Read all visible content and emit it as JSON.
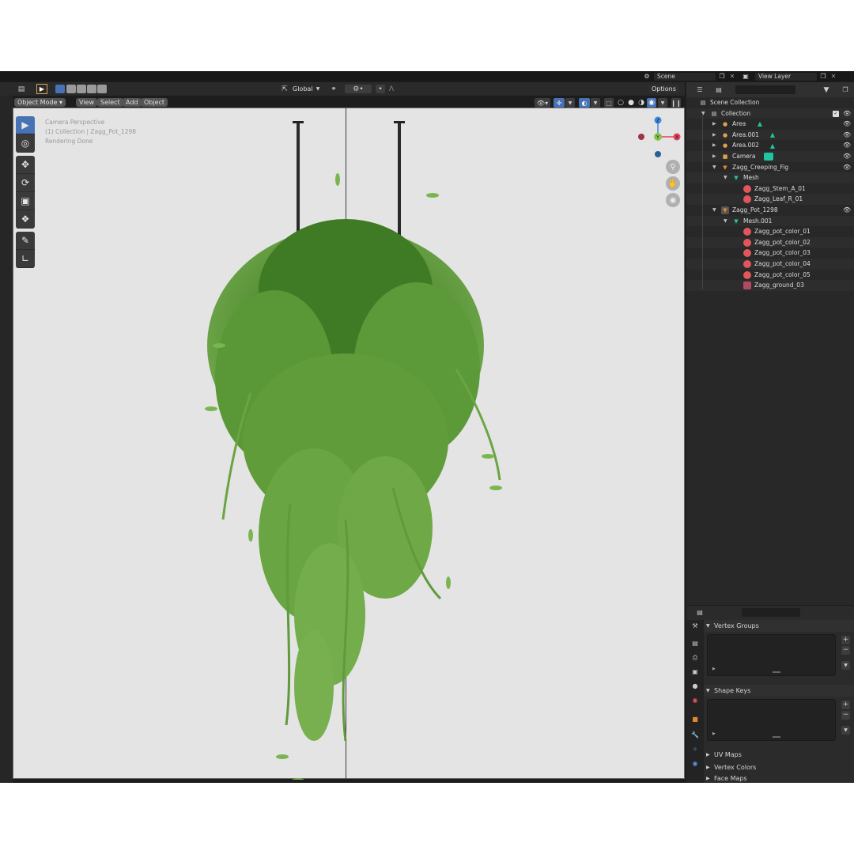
{
  "top_bar": {
    "scene_label": "Scene",
    "view_layer_label": "View Layer"
  },
  "header": {
    "transform_orientation": "Global",
    "options_label": "Options"
  },
  "viewport_menu": {
    "mode": "Object Mode",
    "view": "View",
    "select": "Select",
    "add": "Add",
    "object": "Object"
  },
  "viewport_info": {
    "line1": "Camera Perspective",
    "line2": "(1) Collection | Zagg_Pot_1298",
    "line3": "Rendering Done"
  },
  "gizmo": {
    "z": "Z",
    "y": "Y",
    "x": "X"
  },
  "outliner": {
    "search_placeholder": "",
    "scene_collection": "Scene Collection",
    "items": [
      {
        "label": "Collection"
      },
      {
        "label": "Area"
      },
      {
        "label": "Area.001"
      },
      {
        "label": "Area.002"
      },
      {
        "label": "Camera"
      },
      {
        "label": "Zagg_Creeping_Fig"
      },
      {
        "label": "Mesh"
      },
      {
        "label": "Zagg_Stem_A_01"
      },
      {
        "label": "Zagg_Leaf_R_01"
      },
      {
        "label": "Zagg_Pot_1298"
      },
      {
        "label": "Mesh.001"
      },
      {
        "label": "Zagg_pot_color_01"
      },
      {
        "label": "Zagg_pot_color_02"
      },
      {
        "label": "Zagg_pot_color_03"
      },
      {
        "label": "Zagg_pot_color_04"
      },
      {
        "label": "Zagg_pot_color_05"
      },
      {
        "label": "Zagg_ground_03"
      }
    ]
  },
  "properties": {
    "sections": [
      {
        "label": "Vertex Groups"
      },
      {
        "label": "Shape Keys"
      },
      {
        "label": "UV Maps"
      },
      {
        "label": "Vertex Colors"
      },
      {
        "label": "Face Maps"
      }
    ]
  },
  "colors": {
    "accent": "#4772b3",
    "axis_x": "#e0435a",
    "axis_y": "#8bc34a",
    "axis_z": "#3d8ee0",
    "mesh": "#1fc79e",
    "object": "#e38a2e",
    "material": "#e0565b",
    "light": "#e0a14e"
  }
}
